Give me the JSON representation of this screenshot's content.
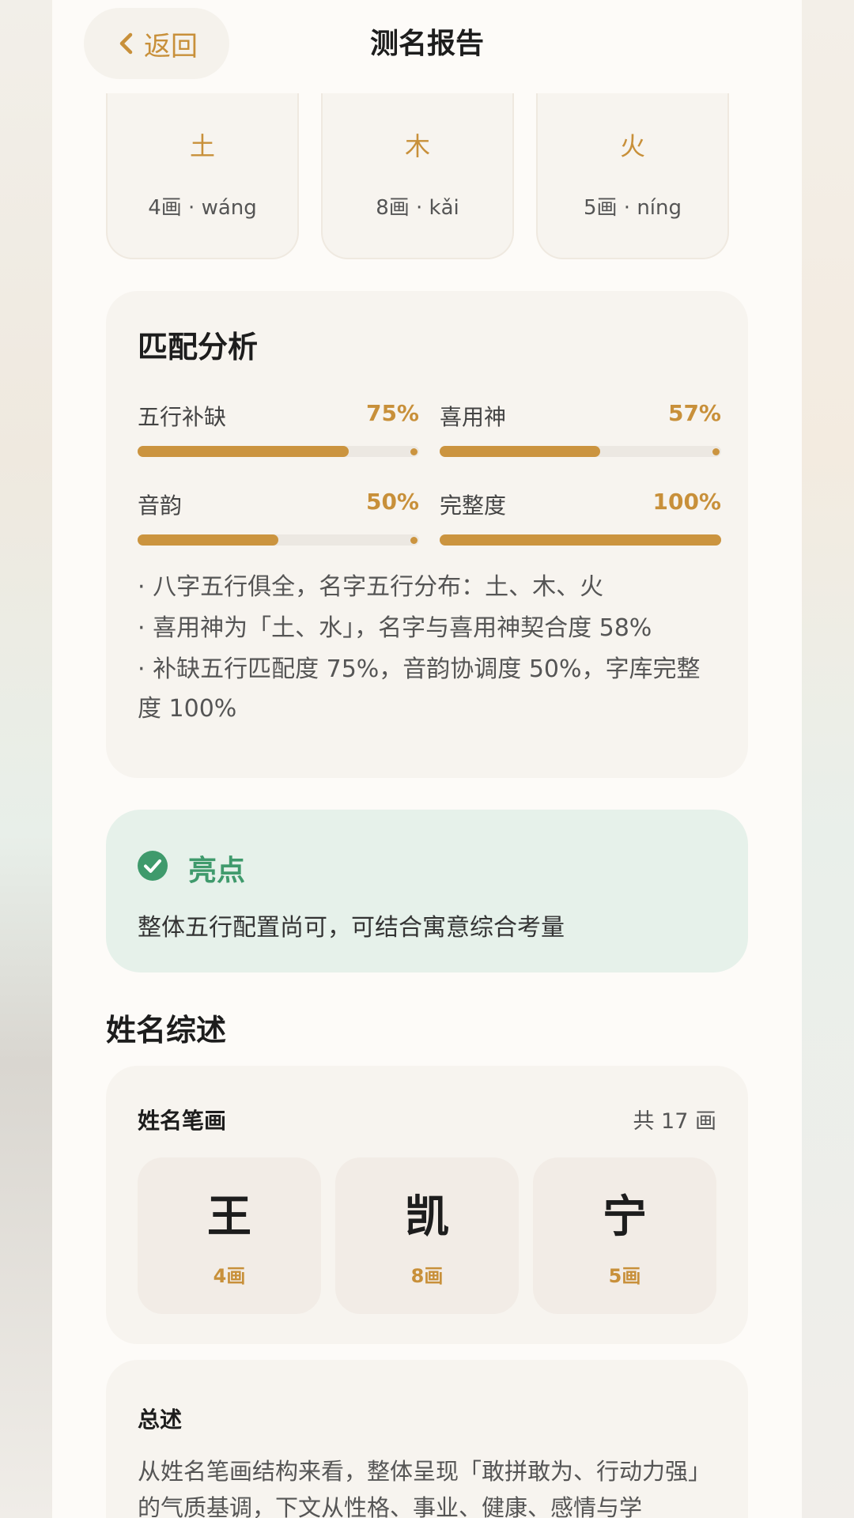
{
  "header": {
    "back_label": "返回",
    "title": "测名报告"
  },
  "characters": [
    {
      "element": "土",
      "strokes_pinyin": "4画 · wáng"
    },
    {
      "element": "木",
      "strokes_pinyin": "8画 · kǎi"
    },
    {
      "element": "火",
      "strokes_pinyin": "5画 · níng"
    }
  ],
  "analysis": {
    "title": "匹配分析",
    "metrics": [
      {
        "label": "五行补缺",
        "value_text": "75%",
        "value": 0.75
      },
      {
        "label": "喜用神",
        "value_text": "57%",
        "value": 0.57
      },
      {
        "label": "音韵",
        "value_text": "50%",
        "value": 0.5
      },
      {
        "label": "完整度",
        "value_text": "100%",
        "value": 1.0
      }
    ],
    "bullets": [
      "· 八字五行俱全，名字五行分布：土、木、火",
      "· 喜用神为「土、水」，名字与喜用神契合度 58%",
      "· 补缺五行匹配度 75%，音韵协调度 50%，字库完整度 100%"
    ]
  },
  "highlight": {
    "title": "亮点",
    "text": "整体五行配置尚可，可结合寓意综合考量",
    "accent": "#3f9a6c"
  },
  "overview": {
    "section_title": "姓名综述",
    "strokes_title": "姓名笔画",
    "strokes_total": "共 17 画",
    "chars": [
      {
        "char": "王",
        "strokes": "4画"
      },
      {
        "char": "凯",
        "strokes": "8画"
      },
      {
        "char": "宁",
        "strokes": "5画"
      }
    ]
  },
  "summary": {
    "title": "总述",
    "text": "从姓名笔画结构来看，整体呈现「敢拼敢为、行动力强」的气质基调，下文从性格、事业、健康、感情与学"
  },
  "colors": {
    "accent": "#c8903a",
    "green": "#3f9a6c"
  }
}
